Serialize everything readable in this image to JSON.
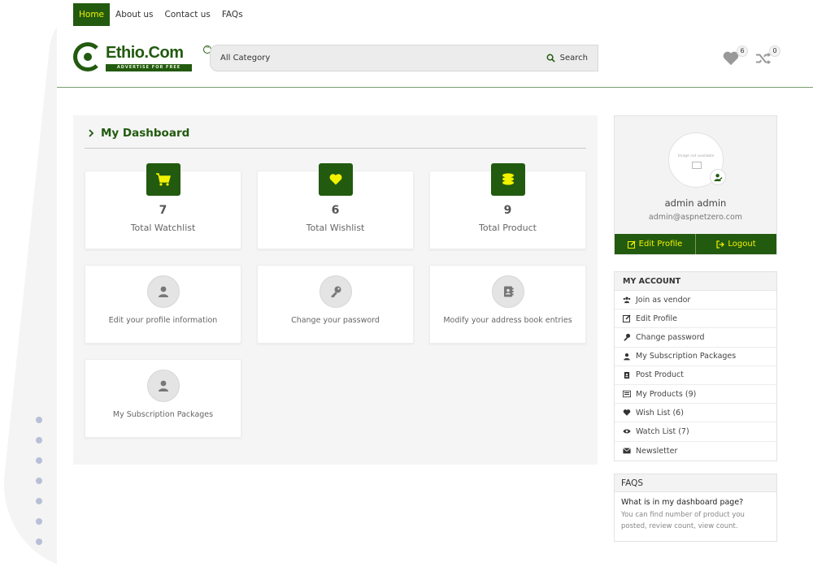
{
  "nav": [
    "Home",
    "About us",
    "Contact us",
    "FAQs"
  ],
  "brand": {
    "name": "Ethio.Com",
    "tagline": "ADVERTISE FOR FREE",
    "accent": "#225a0f",
    "highlight": "#f2f200"
  },
  "search": {
    "category": "All Category",
    "button": "Search"
  },
  "header_icons": {
    "wishlist_count": "6",
    "compare_count": "0"
  },
  "dashboard": {
    "title": "My Dashboard",
    "stats": [
      {
        "value": "7",
        "label": "Total Watchlist",
        "icon": "cart-icon"
      },
      {
        "value": "6",
        "label": "Total Wishlist",
        "icon": "heart-icon"
      },
      {
        "value": "9",
        "label": "Total Product",
        "icon": "coins-icon"
      }
    ],
    "links": [
      {
        "label": "Edit your profile information",
        "icon": "user-icon"
      },
      {
        "label": "Change your password",
        "icon": "key-icon"
      },
      {
        "label": "Modify your address book entries",
        "icon": "address-book-icon"
      },
      {
        "label": "My Subscription Packages",
        "icon": "user-icon"
      }
    ]
  },
  "profile": {
    "no_image": "Image not available",
    "name": "admin admin",
    "email": "admin@aspnetzero.com",
    "edit_label": "Edit Profile",
    "logout_label": "Logout"
  },
  "account": {
    "title": "MY ACCOUNT",
    "items": [
      "Join as vendor",
      "Edit Profile",
      "Change password",
      "My Subscription Packages",
      "Post Product",
      "My Products (9)",
      "Wish List (6)",
      "Watch List (7)",
      "Newsletter"
    ]
  },
  "faqs": {
    "title": "FAQS",
    "question": "What is in my dashboard page?",
    "answer": "You can find number of product you posted, review count, view count."
  }
}
